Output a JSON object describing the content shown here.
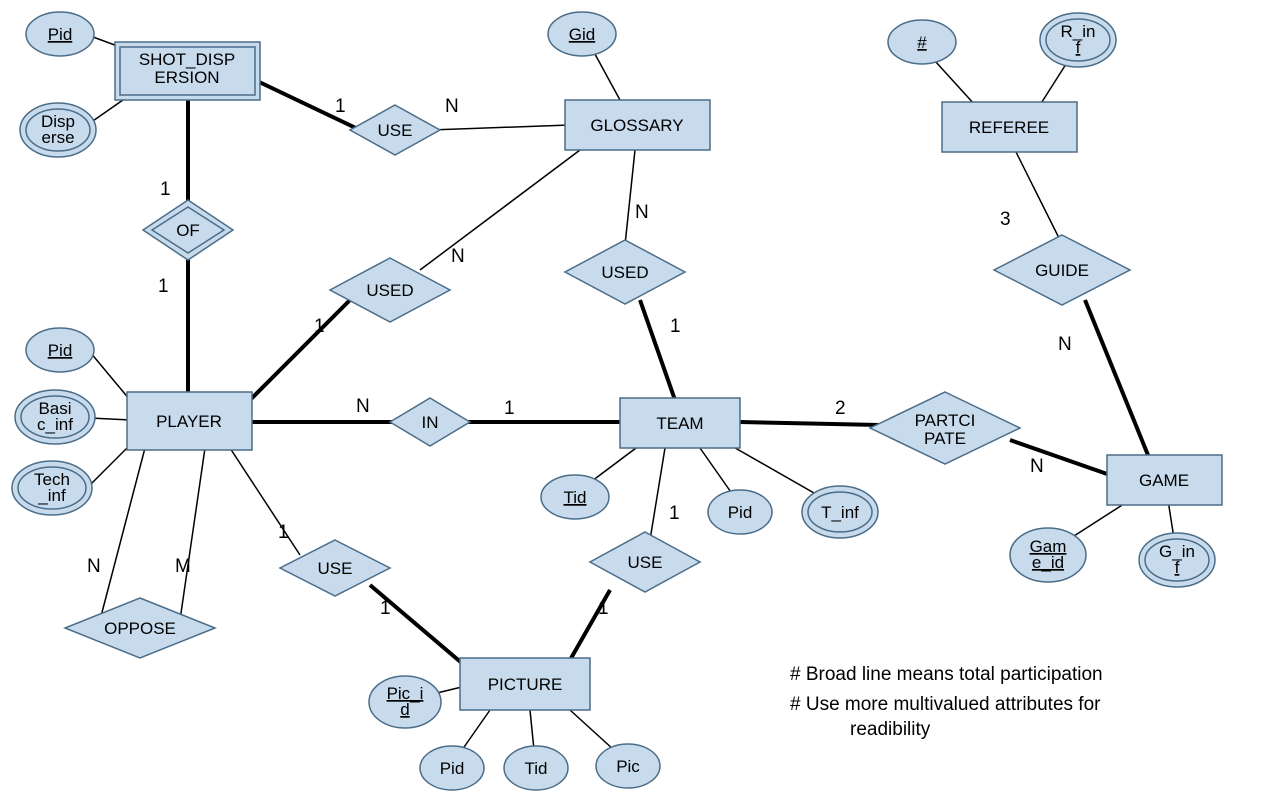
{
  "entities": {
    "shot_dispersion": "SHOT_DISPERSION",
    "glossary": "GLOSSARY",
    "referee": "REFEREE",
    "player": "PLAYER",
    "team": "TEAM",
    "game": "GAME",
    "picture": "PICTURE"
  },
  "relationships": {
    "use_sd_gloss": "USE",
    "of": "OF",
    "used_player_gloss": "USED",
    "used_team_gloss": "USED",
    "in_": "IN",
    "participate": "PARTCIPATE",
    "guide": "GUIDE",
    "oppose": "OPPOSE",
    "use_player_pic": "USE",
    "use_team_pic": "USE"
  },
  "attributes": {
    "sd_pid": "Pid",
    "sd_disperse": "Disperse",
    "gloss_gid": "Gid",
    "ref_num": "#",
    "ref_rinf": "R_inf",
    "player_pid": "Pid",
    "player_basic": "Basic_inf",
    "player_tech": "Tech_inf",
    "team_tid": "Tid",
    "team_pid": "Pid",
    "team_tinf": "T_inf",
    "game_id": "Game_id",
    "game_ginf": "G_inf",
    "pic_id": "Pic_id",
    "pic_pid": "Pid",
    "pic_tid": "Tid",
    "pic_pic": "Pic"
  },
  "cardinalities": {
    "sd_use_1": "1",
    "sd_use_n": "N",
    "of_sd_1": "1",
    "of_player_1": "1",
    "used_pg_n": "N",
    "used_pg_1": "1",
    "used_tg_n": "N",
    "used_tg_1": "1",
    "in_n": "N",
    "in_1": "1",
    "partic_2": "2",
    "partic_n": "N",
    "guide_3": "3",
    "guide_n": "N",
    "oppose_n": "N",
    "oppose_m": "M",
    "use_pp_1a": "1",
    "use_pp_1b": "1",
    "use_tp_1a": "1",
    "use_tp_1b": "1"
  },
  "notes": {
    "l1": "# Broad line means  total participation",
    "l2": "# Use more multivalued attributes for",
    "l3": "readibility"
  }
}
